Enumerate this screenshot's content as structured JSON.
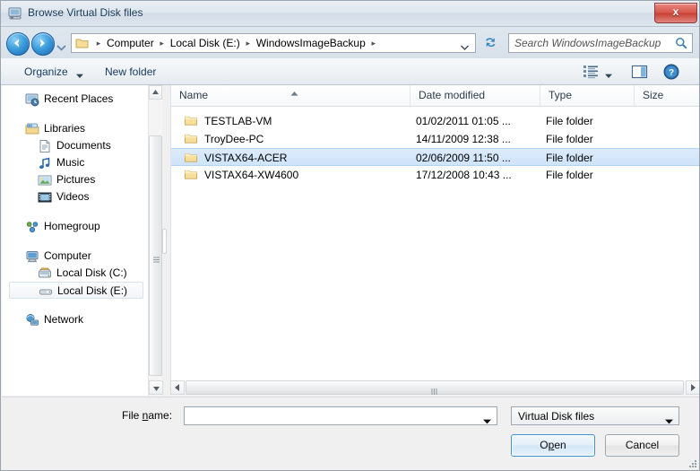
{
  "window": {
    "title": "Browse Virtual Disk files",
    "icon": "virtual-disk-icon",
    "close_label": "x"
  },
  "addressbar": {
    "back_icon": "back-arrow-icon",
    "forward_icon": "forward-arrow-icon",
    "history_icon": "history-dropdown-icon",
    "folder_icon": "folder-icon",
    "breadcrumbs": [
      "Computer",
      "Local Disk (E:)",
      "WindowsImageBackup"
    ],
    "separator": "▸",
    "dropdown_icon": "chevron-down-icon",
    "refresh_icon": "refresh-icon",
    "search_placeholder": "Search WindowsImageBackup",
    "search_value": "",
    "search_icon": "search-icon"
  },
  "toolbar": {
    "organize_label": "Organize",
    "organize_caret": "chevron-down-icon",
    "new_folder_label": "New folder",
    "views_icon": "view-list-icon",
    "views_caret": "chevron-down-icon",
    "preview_pane_icon": "preview-pane-icon",
    "help_icon": "help-icon"
  },
  "navpane": {
    "items": [
      {
        "label": "Recent Places",
        "icon": "recent-places-icon",
        "level": 0,
        "selected": false
      },
      {
        "label": "Libraries",
        "icon": "libraries-icon",
        "level": 0,
        "selected": false,
        "gap_before": true
      },
      {
        "label": "Documents",
        "icon": "documents-icon",
        "level": 1,
        "selected": false
      },
      {
        "label": "Music",
        "icon": "music-icon",
        "level": 1,
        "selected": false
      },
      {
        "label": "Pictures",
        "icon": "pictures-icon",
        "level": 1,
        "selected": false
      },
      {
        "label": "Videos",
        "icon": "videos-icon",
        "level": 1,
        "selected": false
      },
      {
        "label": "Homegroup",
        "icon": "homegroup-icon",
        "level": 0,
        "selected": false,
        "gap_before": true
      },
      {
        "label": "Computer",
        "icon": "computer-icon",
        "level": 0,
        "selected": false,
        "gap_before": true
      },
      {
        "label": "Local Disk (C:)",
        "icon": "hard-drive-icon",
        "level": 1,
        "selected": false
      },
      {
        "label": "Local Disk (E:)",
        "icon": "removable-drive-icon",
        "level": 1,
        "selected": true
      },
      {
        "label": "Network",
        "icon": "network-icon",
        "level": 0,
        "selected": false,
        "gap_before": true
      }
    ],
    "scroll_up_icon": "scroll-up-icon",
    "scroll_down_icon": "scroll-down-icon"
  },
  "filelist": {
    "columns": [
      {
        "label": "Name",
        "sorted": true
      },
      {
        "label": "Date modified",
        "sorted": false
      },
      {
        "label": "Type",
        "sorted": false
      },
      {
        "label": "Size",
        "sorted": false
      }
    ],
    "sort_icon": "sort-ascending-icon",
    "rows": [
      {
        "name": "TESTLAB-VM",
        "date": "01/02/2011 01:05 ...",
        "type": "File folder",
        "size": "",
        "icon": "folder-icon",
        "selected": false
      },
      {
        "name": "TroyDee-PC",
        "date": "14/11/2009 12:38 ...",
        "type": "File folder",
        "size": "",
        "icon": "folder-icon",
        "selected": false
      },
      {
        "name": "VISTAX64-ACER",
        "date": "02/06/2009 11:50 ...",
        "type": "File folder",
        "size": "",
        "icon": "folder-icon",
        "selected": true
      },
      {
        "name": "VISTAX64-XW4600",
        "date": "17/12/2008 10:43 ...",
        "type": "File folder",
        "size": "",
        "icon": "folder-icon",
        "selected": false
      }
    ],
    "hscroll_left_icon": "scroll-left-icon",
    "hscroll_right_icon": "scroll-right-icon"
  },
  "bottom": {
    "filename_label_pre": "File ",
    "filename_label_accel": "n",
    "filename_label_post": "ame:",
    "filename_value": "",
    "filename_caret": "chevron-down-icon",
    "filetype_value": "Virtual Disk files",
    "filetype_caret": "chevron-down-icon",
    "open_label_pre": "O",
    "open_label_accel": "p",
    "open_label_post": "en",
    "cancel_label": "Cancel",
    "resize_grip_icon": "resize-grip-icon"
  },
  "colors": {
    "selection": "#cfe4fa",
    "selection_border": "#b5d4f2",
    "accent_button_border": "#3c94d4",
    "title_text": "#1d3d56",
    "close_button": "#c63f34"
  }
}
